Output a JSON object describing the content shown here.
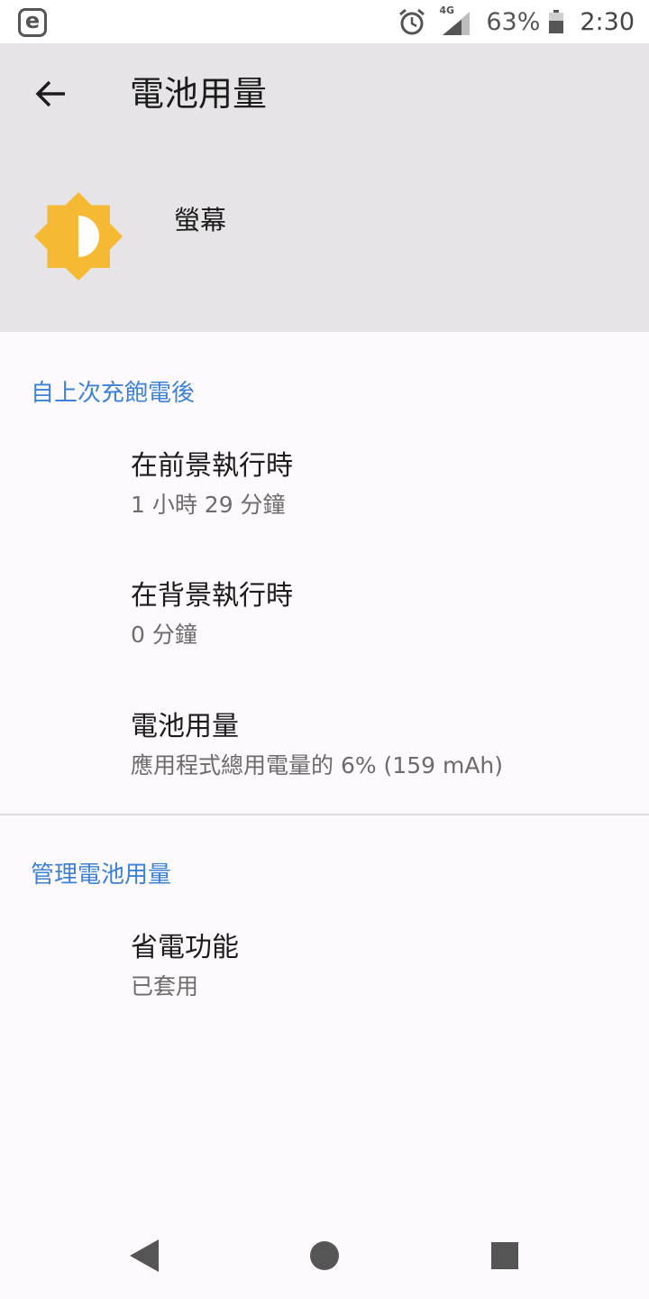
{
  "status_bar": {
    "network_label": "4G",
    "battery_percent_text": "63%",
    "battery_level": 0.63,
    "time": "2:30",
    "icons": [
      "e-app-icon",
      "alarm-icon",
      "signal-icon",
      "battery-icon"
    ]
  },
  "header": {
    "title": "電池用量",
    "app_name": "螢幕",
    "app_icon": "brightness-icon",
    "app_icon_color": "#f6b934"
  },
  "sections": [
    {
      "header": "自上次充飽電後",
      "items": [
        {
          "title": "在前景執行時",
          "summary": "1 小時 29 分鐘"
        },
        {
          "title": "在背景執行時",
          "summary": "0 分鐘"
        },
        {
          "title": "電池用量",
          "summary": "應用程式總用電量的 6% (159 mAh)"
        }
      ]
    },
    {
      "header": "管理電池用量",
      "items": [
        {
          "title": "省電功能",
          "summary": "已套用"
        }
      ]
    }
  ],
  "colors": {
    "accent": "#3c82d6",
    "header_bg": "#e7e4e7",
    "page_bg": "#fdf9fc"
  }
}
